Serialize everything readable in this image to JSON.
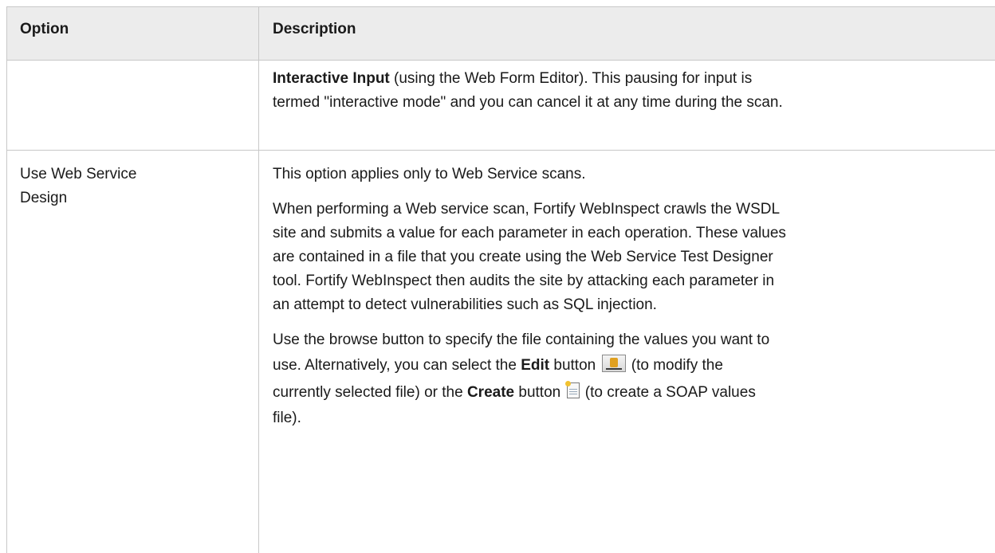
{
  "table": {
    "headers": [
      "Option",
      "Description"
    ],
    "row1": {
      "desc_bold": "Interactive Input",
      "desc_line1_rest": " (using the Web Form Editor). This pausing for input is",
      "desc_line2": "termed \"interactive mode\" and you can cancel it at any time during the scan."
    },
    "row2": {
      "option_line1": "Use Web Service",
      "option_line2": "Design",
      "p1": "This option applies only to Web Service scans.",
      "p2": [
        "When performing a Web service scan, Fortify WebInspect crawls the WSDL",
        "site and submits a value for each parameter in each operation. These values",
        "are contained in a file that you create using the Web Service Test Designer",
        "tool. Fortify WebInspect then audits the site by attacking each parameter in",
        "an attempt to detect vulnerabilities such as SQL injection."
      ],
      "p3_line1": "Use the browse button to specify the file containing the values you want to",
      "p3_line2_a": "use. Alternatively, you can select the ",
      "p3_edit": "Edit",
      "p3_line2_b": " button",
      "p3_line2_c": " (to modify the",
      "p3_line3_a": "currently selected file) or the ",
      "p3_create": "Create",
      "p3_line3_b": " button",
      "p3_line3_c": " (to create a SOAP values",
      "p3_line4": "file)."
    }
  },
  "icons": {
    "edit": "edit-soap-values-icon",
    "create": "create-soap-values-icon"
  }
}
